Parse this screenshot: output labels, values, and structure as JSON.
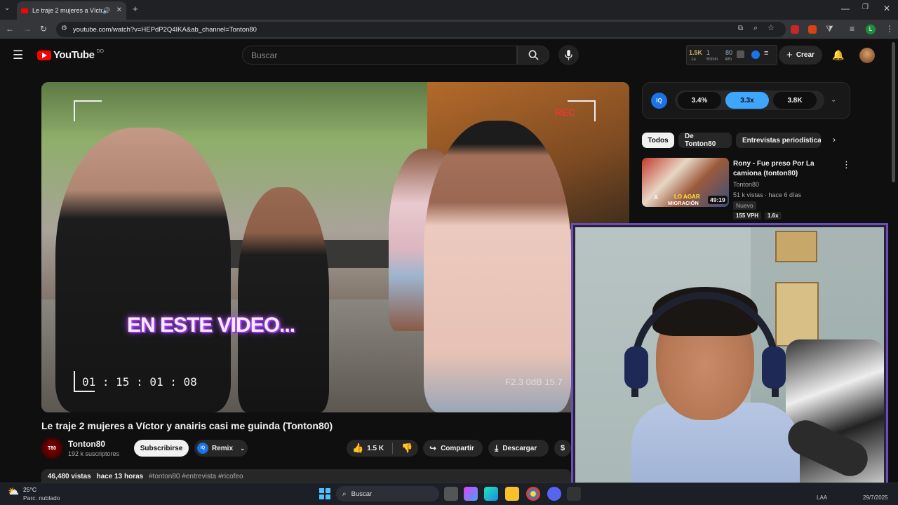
{
  "browser": {
    "tab_title": "Le traje 2 mujeres a Víctor y",
    "url": "youtube.com/watch?v=HEPdP2Q4IKA&ab_channel=Tonton80"
  },
  "youtube": {
    "logo_text": "YouTube",
    "region": "DO",
    "search_placeholder": "Buscar",
    "create_label": "Crear",
    "stats": {
      "views_1a": "1.5K",
      "views_1a_label": "1a",
      "views_60": "1",
      "views_60_label": "60min",
      "views_48": "80",
      "views_48_label": "48h"
    }
  },
  "video": {
    "overlay_rec": "REC",
    "overlay_caption": "EN ESTE VIDEO...",
    "overlay_timecode": "01 : 15 : 01 : 08",
    "overlay_settings": "F2.3  0dB 15.7",
    "title": "Le traje 2 mujeres a Víctor y anairis casi me guinda (Tonton80)",
    "channel": "Tonton80",
    "subscribers": "192 k suscriptores",
    "subscribe_label": "Subscribirse",
    "remix_label": "Remix",
    "likes": "1.5 K",
    "share_label": "Compartir",
    "download_label": "Descargar",
    "views": "46,480 vistas",
    "age": "hace 13 horas",
    "hashtags": "#tonton80 #entrevista #ricofeo"
  },
  "iq": {
    "pill_1": "3.4%",
    "pill_2": "3.3x",
    "pill_3": "3.8K"
  },
  "chips": [
    "Todos",
    "De Tonton80",
    "Entrevistas periodísticas"
  ],
  "related": {
    "title_line1": "Rony - Fue preso Por La",
    "title_line2": "camiona (tonton80)",
    "channel": "Tonton80",
    "meta": "51 k vistas · hace 6 días",
    "badge": "Nuevo",
    "duration": "49:19",
    "thumb_text_1": "A",
    "thumb_text_2": "LO AGAR",
    "thumb_text_3": "MIGRACIÓN",
    "vph": "155 VPH",
    "ratio": "1.6x"
  },
  "taskbar": {
    "temp": "25°C",
    "weather": "Parc. nublado",
    "search": "Buscar",
    "lang": "LAA",
    "date": "29/7/2025"
  },
  "colors": {
    "yt_red": "#ff0000",
    "iq_blue": "#3ea6ff",
    "cam_border": "#6b4fb5"
  }
}
